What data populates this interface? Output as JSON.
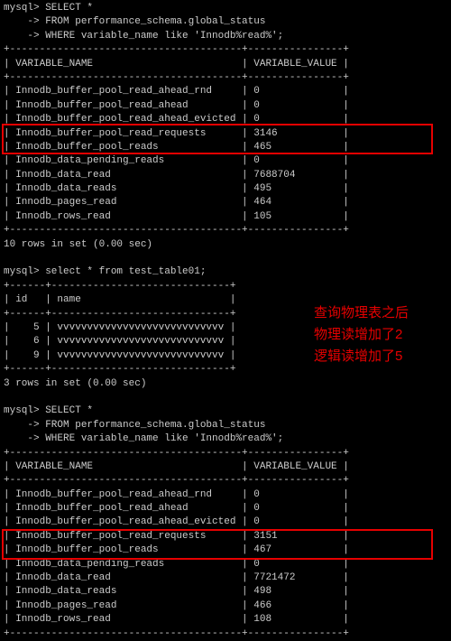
{
  "query1": {
    "prompt": "mysql> SELECT *",
    "line2": "    -> FROM performance_schema.global_status",
    "line3": "    -> WHERE variable_name like 'Innodb%read%';"
  },
  "table1": {
    "border": "+---------------------------------------+----------------+",
    "header": "| VARIABLE_NAME                         | VARIABLE_VALUE |",
    "rows": [
      "| Innodb_buffer_pool_read_ahead_rnd     | 0              |",
      "| Innodb_buffer_pool_read_ahead         | 0              |",
      "| Innodb_buffer_pool_read_ahead_evicted | 0              |",
      "| Innodb_buffer_pool_read_requests      | 3146           |",
      "| Innodb_buffer_pool_reads              | 465            |",
      "| Innodb_data_pending_reads             | 0              |",
      "| Innodb_data_read                      | 7688704        |",
      "| Innodb_data_reads                     | 495            |",
      "| Innodb_pages_read                     | 464            |",
      "| Innodb_rows_read                      | 105            |"
    ],
    "footer": "10 rows in set (0.00 sec)"
  },
  "query2": {
    "prompt": "mysql> select * from test_table01;"
  },
  "table2": {
    "border": "+------+------------------------------+",
    "header": "| id   | name                         |",
    "rows": [
      "|    5 | vvvvvvvvvvvvvvvvvvvvvvvvvvvv |",
      "|    6 | vvvvvvvvvvvvvvvvvvvvvvvvvvvv |",
      "|    9 | vvvvvvvvvvvvvvvvvvvvvvvvvvvv |"
    ],
    "footer": "3 rows in set (0.00 sec)"
  },
  "query3": {
    "prompt": "mysql> SELECT *",
    "line2": "    -> FROM performance_schema.global_status",
    "line3": "    -> WHERE variable_name like 'Innodb%read%';"
  },
  "table3": {
    "border": "+---------------------------------------+----------------+",
    "header": "| VARIABLE_NAME                         | VARIABLE_VALUE |",
    "rows": [
      "| Innodb_buffer_pool_read_ahead_rnd     | 0              |",
      "| Innodb_buffer_pool_read_ahead         | 0              |",
      "| Innodb_buffer_pool_read_ahead_evicted | 0              |",
      "| Innodb_buffer_pool_read_requests      | 3151           |",
      "| Innodb_buffer_pool_reads              | 467            |",
      "| Innodb_data_pending_reads             | 0              |",
      "| Innodb_data_read                      | 7721472        |",
      "| Innodb_data_reads                     | 498            |",
      "| Innodb_pages_read                     | 466            |",
      "| Innodb_rows_read                      | 108            |"
    ]
  },
  "annotations": {
    "line1": "查询物理表之后",
    "line2": "物理读增加了2",
    "line3": "逻辑读增加了5"
  }
}
